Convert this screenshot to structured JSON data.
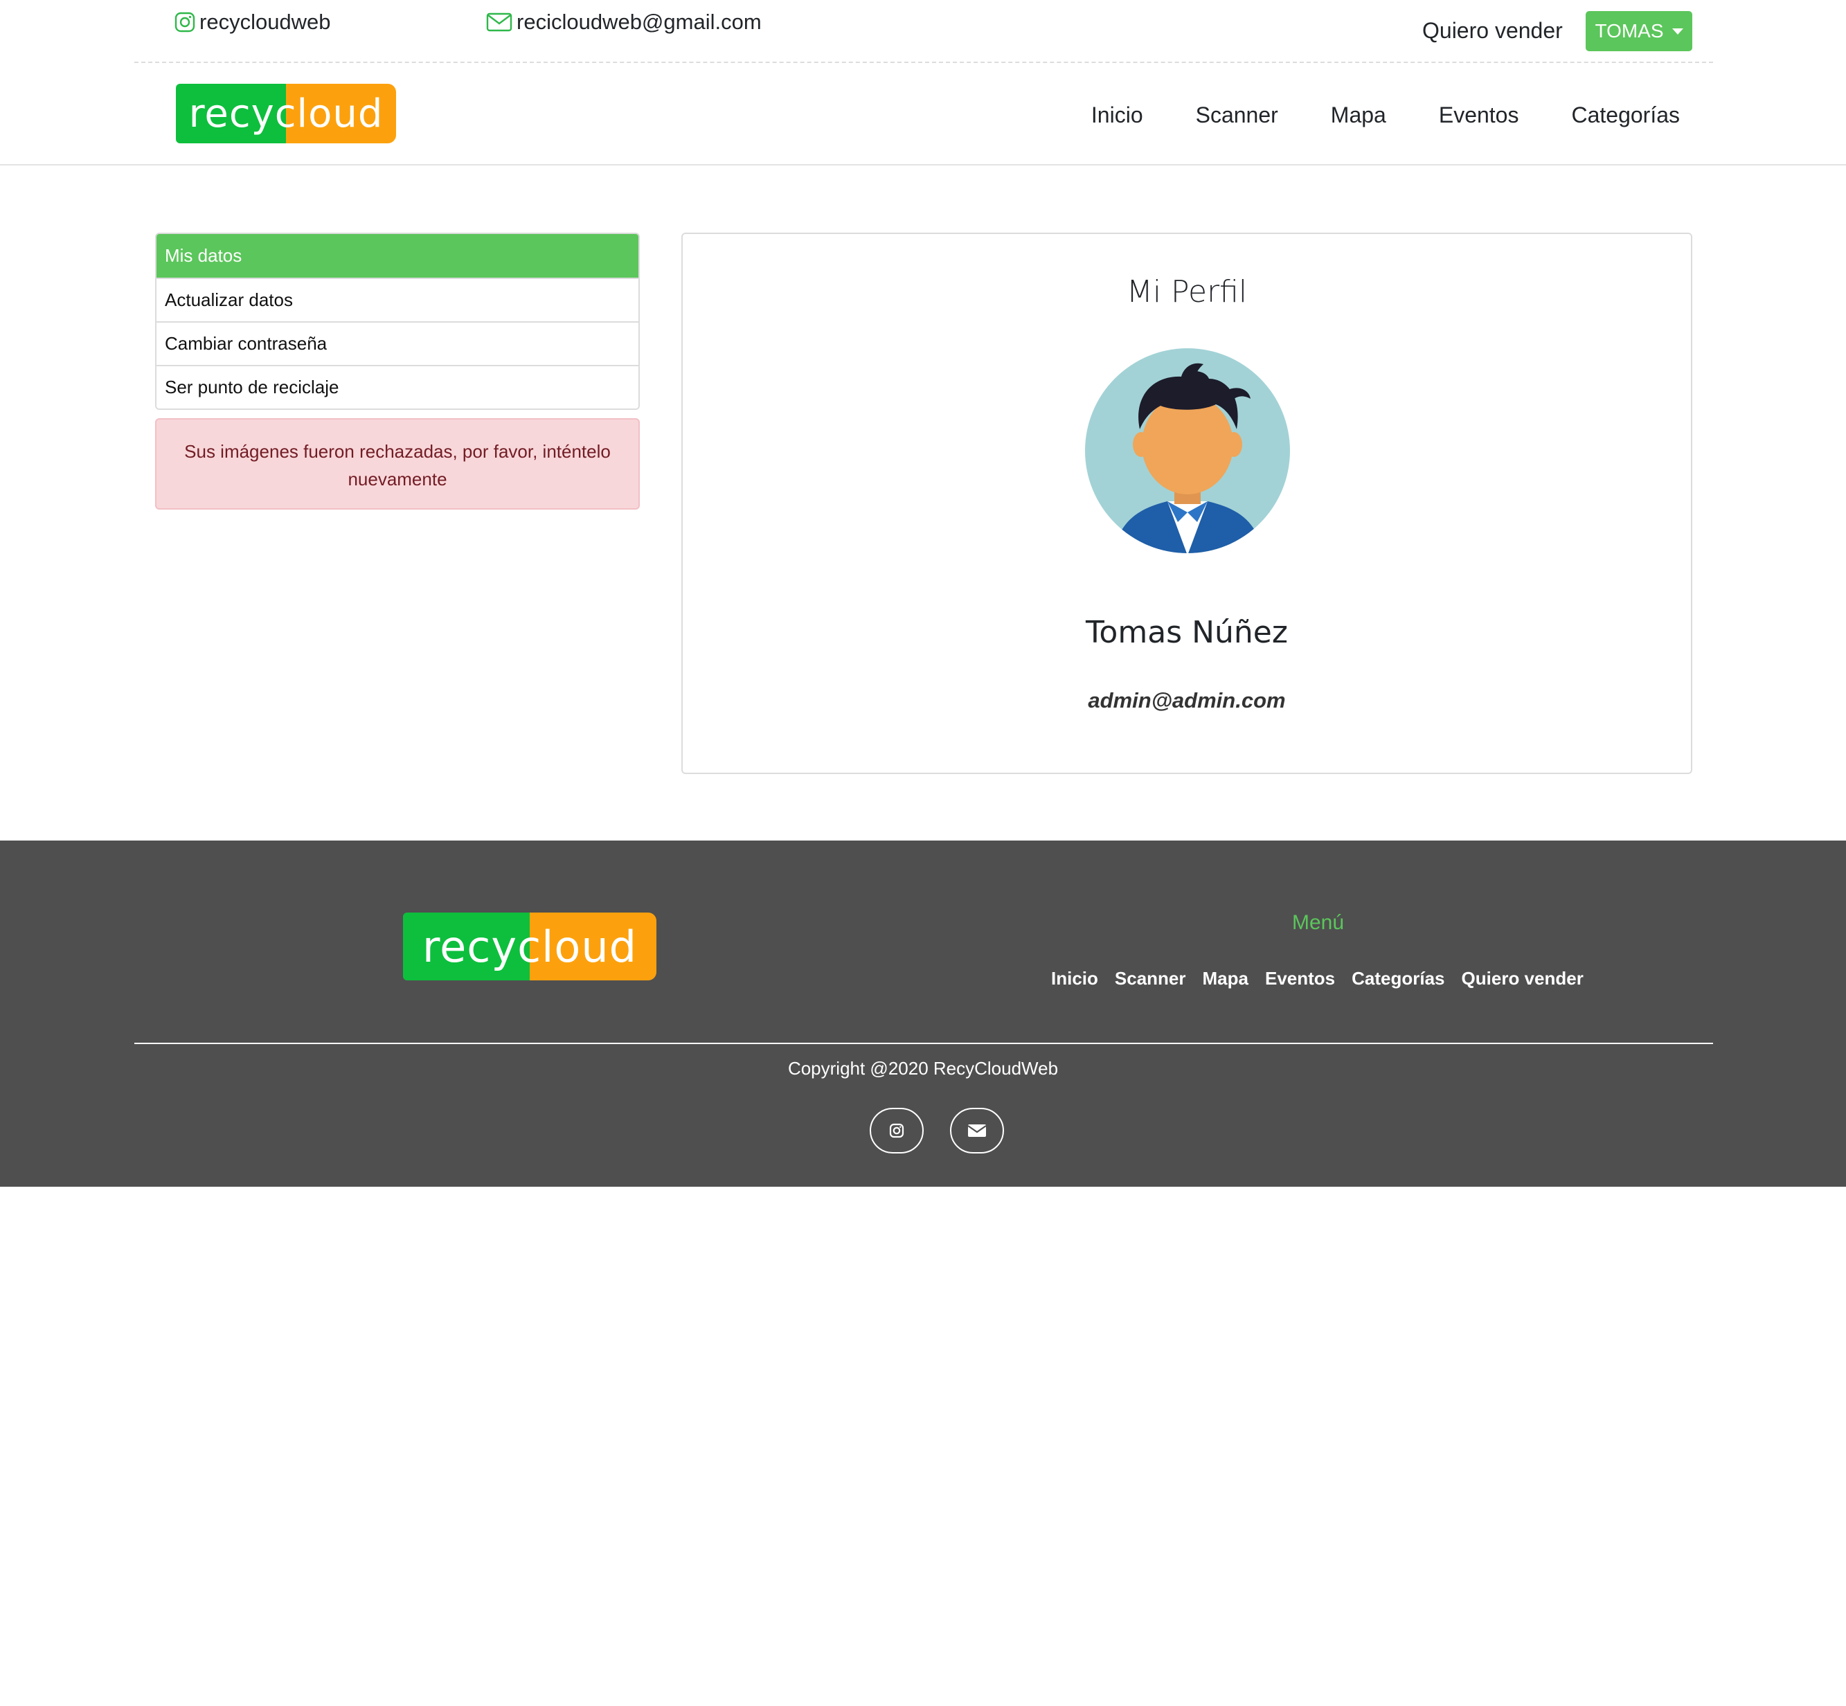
{
  "topbar": {
    "instagram_handle": "recycloudweb",
    "email": "recicloudweb@gmail.com",
    "sell_link": "Quiero vender",
    "user_button": "TOMAS"
  },
  "brand": {
    "logo_text": "recycloud",
    "green": "#0dbf3d",
    "orange": "#fca10d",
    "accent": "#5bc65b"
  },
  "nav": {
    "links": [
      "Inicio",
      "Scanner",
      "Mapa",
      "Eventos",
      "Categorías"
    ]
  },
  "sidebar": {
    "items": [
      {
        "label": "Mis datos",
        "active": true
      },
      {
        "label": "Actualizar datos",
        "active": false
      },
      {
        "label": "Cambiar contraseña",
        "active": false
      },
      {
        "label": "Ser punto de reciclaje",
        "active": false
      }
    ],
    "alert": "Sus imágenes fueron rechazadas, por favor, inténtelo nuevamente"
  },
  "profile": {
    "title": "Mi Perfil",
    "name": "Tomas Núñez",
    "email": "admin@admin.com"
  },
  "footer": {
    "menu_title": "Menú",
    "menu_links": [
      "Inicio",
      "Scanner",
      "Mapa",
      "Eventos",
      "Categorías",
      "Quiero vender"
    ],
    "copyright": "Copyright @2020 RecyCloudWeb",
    "social": [
      "instagram-icon",
      "envelope-icon"
    ]
  }
}
